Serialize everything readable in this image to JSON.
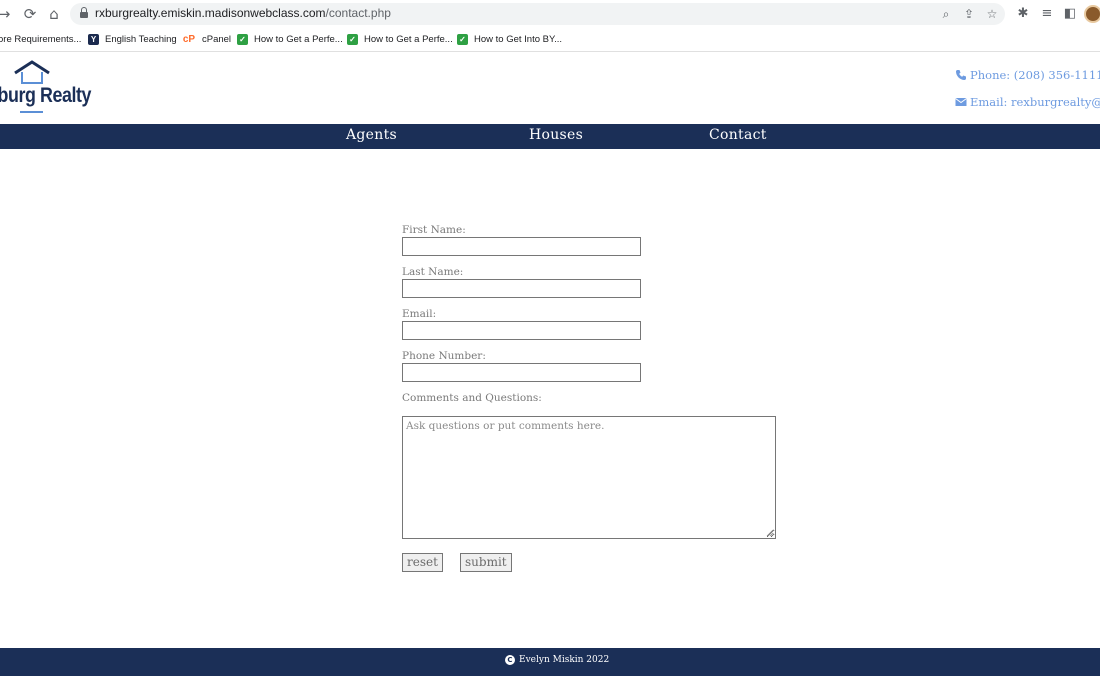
{
  "browser": {
    "url_domain": "rxburgrealty.emiskin.madisonwebclass.com",
    "url_path": "/contact.php",
    "bookmarks": [
      {
        "label": "ore Requirements...",
        "icon": "none"
      },
      {
        "label": "English Teaching",
        "icon": "byu-icon"
      },
      {
        "label": "cPanel",
        "icon": "cpanel-icon"
      },
      {
        "label": "How to Get a Perfe...",
        "icon": "check-icon"
      },
      {
        "label": "How to Get a Perfe...",
        "icon": "check-icon"
      },
      {
        "label": "How to Get Into BY...",
        "icon": "check-icon"
      }
    ]
  },
  "header": {
    "logo_text": "xburg Realty",
    "phone": "Phone: (208) 356-1111",
    "email": "Email: rexburgrealty@gma"
  },
  "nav": {
    "items": [
      "Agents",
      "Houses",
      "Contact"
    ]
  },
  "form": {
    "first_name_label": "First Name:",
    "last_name_label": "Last Name:",
    "email_label": "Email:",
    "phone_label": "Phone Number:",
    "comments_label": "Comments and Questions:",
    "comments_placeholder": "Ask questions or put comments here.",
    "reset_label": "reset",
    "submit_label": "submit"
  },
  "footer": {
    "text": "Evelyn Miskin 2022"
  },
  "colors": {
    "navy": "#1b2f57",
    "accent_blue": "#6e9be0"
  }
}
